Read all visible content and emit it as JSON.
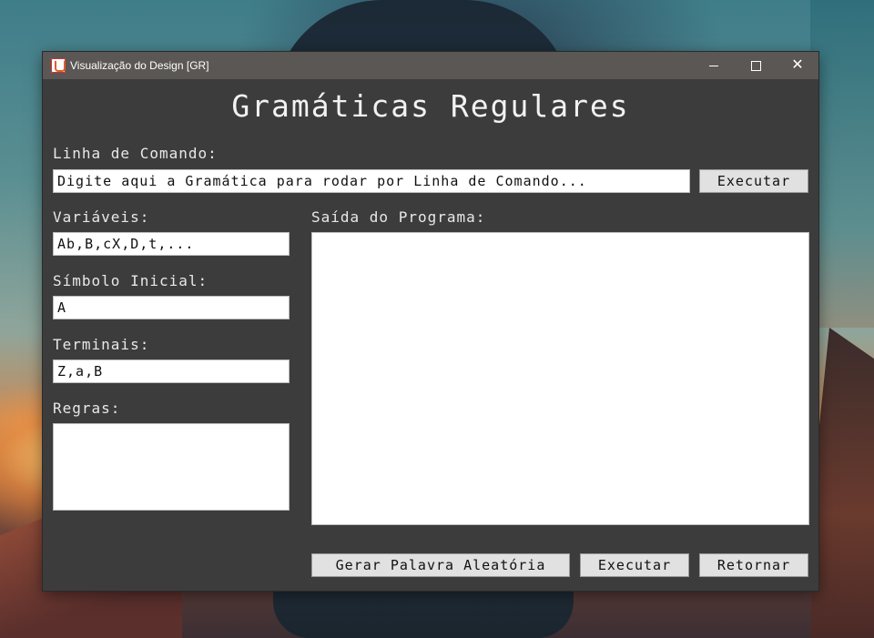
{
  "window": {
    "title": "Visualização do Design [GR]",
    "minimize_label": "",
    "maximize_label": "",
    "close_label": "✕"
  },
  "main": {
    "heading": "Gramáticas Regulares",
    "command_line": {
      "label": "Linha de Comando:",
      "value": "Digite aqui a Gramática para rodar por Linha de Comando...",
      "execute_label": "Executar"
    },
    "variables": {
      "label": "Variáveis:",
      "value": "Ab,B,cX,D,t,..."
    },
    "start_symbol": {
      "label": "Símbolo Inicial:",
      "value": "A"
    },
    "terminals": {
      "label": "Terminais:",
      "value": "Z,a,B"
    },
    "rules": {
      "label": "Regras:",
      "value": ""
    },
    "output": {
      "label": "Saída do Programa:",
      "value": ""
    },
    "buttons": {
      "random_word": "Gerar Palavra Aleatória",
      "execute": "Executar",
      "back": "Retornar"
    }
  }
}
